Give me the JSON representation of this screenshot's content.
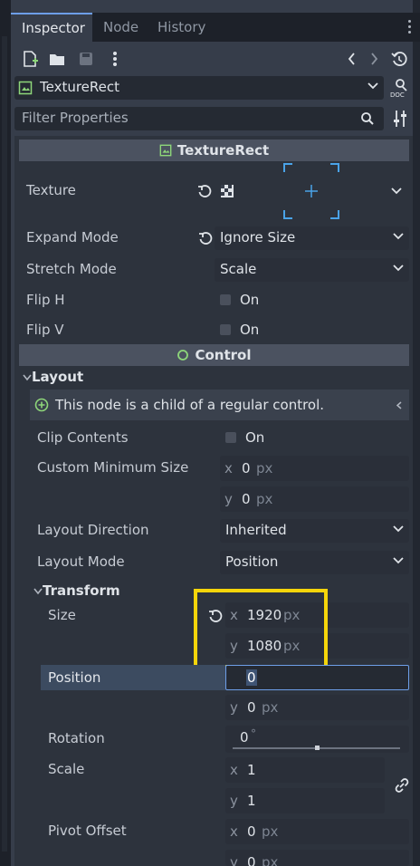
{
  "tabs": [
    {
      "label": "Inspector",
      "active": true
    },
    {
      "label": "Node",
      "active": false
    },
    {
      "label": "History",
      "active": false
    }
  ],
  "object_selector": {
    "value": "TextureRect"
  },
  "filter": {
    "placeholder": "Filter Properties"
  },
  "texturerect_section": {
    "title": "TextureRect",
    "texture_label": "Texture",
    "expand_mode_label": "Expand Mode",
    "expand_mode_value": "Ignore Size",
    "stretch_mode_label": "Stretch Mode",
    "stretch_mode_value": "Scale",
    "flip_h_label": "Flip H",
    "flip_h_value": "On",
    "flip_v_label": "Flip V",
    "flip_v_value": "On"
  },
  "control_section": {
    "title": "Control"
  },
  "layout_group": {
    "title": "Layout",
    "info": "This node is a child of a regular control.",
    "clip_contents_label": "Clip Contents",
    "clip_contents_value": "On",
    "custom_min_size_label": "Custom Minimum Size",
    "custom_min_x": "0",
    "custom_min_y": "0",
    "unit": "px",
    "layout_direction_label": "Layout Direction",
    "layout_direction_value": "Inherited",
    "layout_mode_label": "Layout Mode",
    "layout_mode_value": "Position"
  },
  "transform_group": {
    "title": "Transform",
    "size_label": "Size",
    "size_x": "1920",
    "size_y": "1080",
    "position_label": "Position",
    "position_x_input": "0",
    "position_y": "0",
    "rotation_label": "Rotation",
    "rotation_value": "0",
    "rotation_unit": "°",
    "rotation_slider_fraction": 0.5,
    "scale_label": "Scale",
    "scale_x": "1",
    "scale_y": "1",
    "pivot_label": "Pivot Offset",
    "pivot_x": "0",
    "pivot_y": "0",
    "unit": "px"
  },
  "axis": {
    "x": "x",
    "y": "y"
  },
  "colors": {
    "accent": "#6d9ee8",
    "highlight": "#f5d50a",
    "section_header": "#4b5260",
    "panel": "#363d4a",
    "input": "#252a33",
    "green": "#8ed67a",
    "texture_outline": "#4aa3e8"
  },
  "icons": [
    "new-resource-icon",
    "open-folder-icon",
    "save-icon",
    "kebab-menu-icon",
    "history-back-icon",
    "history-forward-icon",
    "object-history-icon",
    "texturerect-icon",
    "chevron-down-icon",
    "docs-icon",
    "search-icon",
    "tools-icon",
    "revert-icon",
    "transparent-checker-icon",
    "control-circle-icon",
    "expand-arrow-icon",
    "add-circle-icon",
    "collapse-left-icon",
    "link-icon"
  ]
}
